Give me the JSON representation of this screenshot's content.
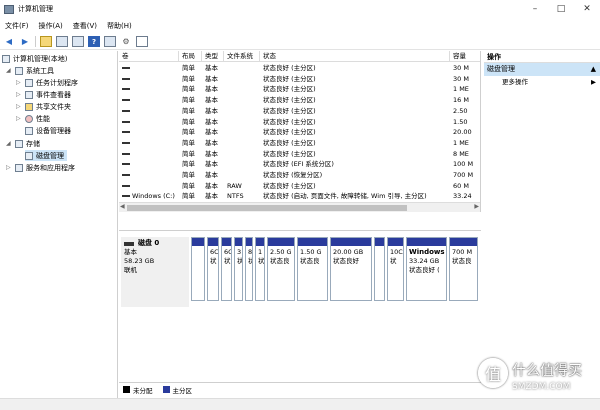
{
  "window": {
    "title": "计算机管理"
  },
  "menu": [
    "文件(F)",
    "操作(A)",
    "查看(V)",
    "帮助(H)"
  ],
  "tree": {
    "root": "计算机管理(本地)",
    "system_tools": "系统工具",
    "task_scheduler": "任务计划程序",
    "event_viewer": "事件查看器",
    "shared_folders": "共享文件夹",
    "performance": "性能",
    "device_manager": "设备管理器",
    "storage": "存储",
    "disk_management": "磁盘管理",
    "services": "服务和应用程序"
  },
  "columns": [
    "卷",
    "布局",
    "类型",
    "文件系统",
    "状态",
    "容量"
  ],
  "rows": [
    {
      "vol": "",
      "layout": "简单",
      "type": "基本",
      "fs": "",
      "status": "状态良好 (主分区)",
      "cap": "30 M"
    },
    {
      "vol": "",
      "layout": "简单",
      "type": "基本",
      "fs": "",
      "status": "状态良好 (主分区)",
      "cap": "30 M"
    },
    {
      "vol": "",
      "layout": "简单",
      "type": "基本",
      "fs": "",
      "status": "状态良好 (主分区)",
      "cap": "1 ME"
    },
    {
      "vol": "",
      "layout": "简单",
      "type": "基本",
      "fs": "",
      "status": "状态良好 (主分区)",
      "cap": "16 M"
    },
    {
      "vol": "",
      "layout": "简单",
      "type": "基本",
      "fs": "",
      "status": "状态良好 (主分区)",
      "cap": "2.50"
    },
    {
      "vol": "",
      "layout": "简单",
      "type": "基本",
      "fs": "",
      "status": "状态良好 (主分区)",
      "cap": "1.50"
    },
    {
      "vol": "",
      "layout": "简单",
      "type": "基本",
      "fs": "",
      "status": "状态良好 (主分区)",
      "cap": "20.00"
    },
    {
      "vol": "",
      "layout": "简单",
      "type": "基本",
      "fs": "",
      "status": "状态良好 (主分区)",
      "cap": "1 ME"
    },
    {
      "vol": "",
      "layout": "简单",
      "type": "基本",
      "fs": "",
      "status": "状态良好 (主分区)",
      "cap": "8 ME"
    },
    {
      "vol": "",
      "layout": "简单",
      "type": "基本",
      "fs": "",
      "status": "状态良好 (EFI 系统分区)",
      "cap": "100 M"
    },
    {
      "vol": "",
      "layout": "简单",
      "type": "基本",
      "fs": "",
      "status": "状态良好 (恢复分区)",
      "cap": "700 M"
    },
    {
      "vol": "",
      "layout": "简单",
      "type": "基本",
      "fs": "RAW",
      "status": "状态良好 (主分区)",
      "cap": "60 M"
    },
    {
      "vol": "Windows (C:)",
      "layout": "简单",
      "type": "基本",
      "fs": "NTFS",
      "status": "状态良好 (启动, 页面文件, 故障转储, Wim 引导, 主分区)",
      "cap": "33.24"
    }
  ],
  "disk": {
    "name": "磁盘 0",
    "type": "基本",
    "size": "58.23 GB",
    "state": "联机"
  },
  "partitions": [
    {
      "l1": "",
      "l2": ""
    },
    {
      "l1": "6C",
      "l2": "状"
    },
    {
      "l1": "6C",
      "l2": "状"
    },
    {
      "l1": "3",
      "l2": "状"
    },
    {
      "l1": "8",
      "l2": "状"
    },
    {
      "l1": "1",
      "l2": "状"
    },
    {
      "l1": "2.50 G",
      "l2": "状态良"
    },
    {
      "l1": "1.50 G",
      "l2": "状态良"
    },
    {
      "l1": "20.00 GB",
      "l2": "状态良好"
    },
    {
      "l1": "",
      "l2": ""
    },
    {
      "l1": "10C",
      "l2": "状"
    },
    {
      "l1": "Windows",
      "l2": "33.24 GB",
      "l3": "状态良好 ("
    },
    {
      "l1": "700 M",
      "l2": "状态良"
    }
  ],
  "legend": {
    "unallocated": "未分配",
    "primary": "主分区",
    "unallocated_color": "#000000",
    "primary_color": "#2a3b9c"
  },
  "actions": {
    "header": "操作",
    "section": "磁盘管理",
    "more": "更多操作"
  },
  "watermark": {
    "cn": "什么值得买",
    "en": "SMZDM.COM",
    "logo": "值"
  }
}
